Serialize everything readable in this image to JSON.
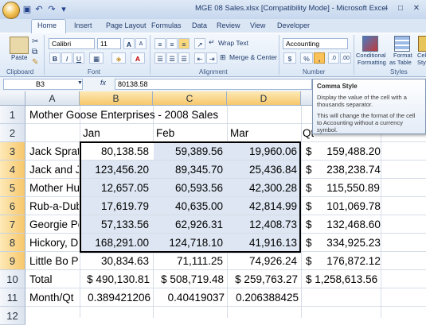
{
  "window": {
    "title": "MGE 08 Sales.xlsx  [Compatibility Mode]  -  Microsoft Excel",
    "minimize": "–",
    "maximize": "□",
    "close": "✕"
  },
  "tabs": [
    "Home",
    "Insert",
    "Page Layout",
    "Formulas",
    "Data",
    "Review",
    "View",
    "Developer"
  ],
  "ribbon": {
    "clipboard": {
      "paste": "Paste",
      "label": "Clipboard"
    },
    "font": {
      "name": "Calibri",
      "size": "11",
      "label": "Font",
      "bold": "B",
      "italic": "I",
      "underline": "U",
      "grow": "A",
      "shrink": "A",
      "font_color": "A"
    },
    "alignment": {
      "wrap": "Wrap Text",
      "merge": "Merge & Center",
      "label": "Alignment"
    },
    "number": {
      "format": "Accounting",
      "currency": "$",
      "percent": "%",
      "comma": ",",
      "label": "Number"
    },
    "styles": {
      "conditional": "Conditional",
      "conditional2": "Formatting",
      "format_table": "Format",
      "format_table2": "as Table",
      "cell_styles": "Cell",
      "cell_styles2": "Styl",
      "label": "Styles"
    }
  },
  "formula_bar": {
    "name_box": "B3",
    "fx": "fx",
    "value": "80138.58"
  },
  "columns": [
    "A",
    "B",
    "C",
    "D"
  ],
  "selected_column": "B",
  "rows": [
    {
      "num": "1",
      "a": "Mother Goose Enterprises - 2008 Sales",
      "b": "",
      "c": "",
      "d": "",
      "e": ""
    },
    {
      "num": "2",
      "a": "",
      "b": "Jan",
      "c": "Feb",
      "d": "Mar",
      "e": "Qt"
    },
    {
      "num": "3",
      "a": "Jack Sprat",
      "b": "80,138.58",
      "c": "59,389.56",
      "d": "19,960.06",
      "e": "$     159,488.20"
    },
    {
      "num": "4",
      "a": "Jack and Ji",
      "b": "123,456.20",
      "c": "89,345.70",
      "d": "25,436.84",
      "e": "$     238,238.74"
    },
    {
      "num": "5",
      "a": "Mother Hu",
      "b": "12,657.05",
      "c": "60,593.56",
      "d": "42,300.28",
      "e": "$     115,550.89"
    },
    {
      "num": "6",
      "a": "Rub-a-Dub",
      "b": "17,619.79",
      "c": "40,635.00",
      "d": "42,814.99",
      "e": "$     101,069.78"
    },
    {
      "num": "7",
      "a": "Georgie Po",
      "b": "57,133.56",
      "c": "62,926.31",
      "d": "12,408.73",
      "e": "$     132,468.60"
    },
    {
      "num": "8",
      "a": "Hickory, Di",
      "b": "168,291.00",
      "c": "124,718.10",
      "d": "41,916.13",
      "e": "$     334,925.23"
    },
    {
      "num": "9",
      "a": "Little Bo P",
      "b": "30,834.63",
      "c": "71,111.25",
      "d": "74,926.24",
      "e": "$     176,872.12"
    },
    {
      "num": "10",
      "a": "Total",
      "b": "$ 490,130.81",
      "c": "$ 508,719.48",
      "d": "$ 259,763.27",
      "e": "$ 1,258,613.56"
    },
    {
      "num": "11",
      "a": "",
      "b": "",
      "c": "",
      "d": "",
      "e": ""
    },
    {
      "num": "12",
      "a": "Month/Qt",
      "b": "0.389421206",
      "c": "0.40419037",
      "d": "0.206388425",
      "e": ""
    },
    {
      "num": "13",
      "a": "",
      "b": "",
      "c": "",
      "d": "",
      "e": ""
    }
  ],
  "selected_rows": [
    "3",
    "4",
    "5",
    "6",
    "7",
    "8",
    "9"
  ],
  "tooltip": {
    "title": "Comma Style",
    "line1": "Display the value of the cell with a thousands separator.",
    "line2": "This will change the format of the cell to Accounting without a currency symbol."
  },
  "colors": {
    "accent": "#dbe6f4",
    "selection": "#dde6f2",
    "header_selected": "#f7c76b"
  }
}
